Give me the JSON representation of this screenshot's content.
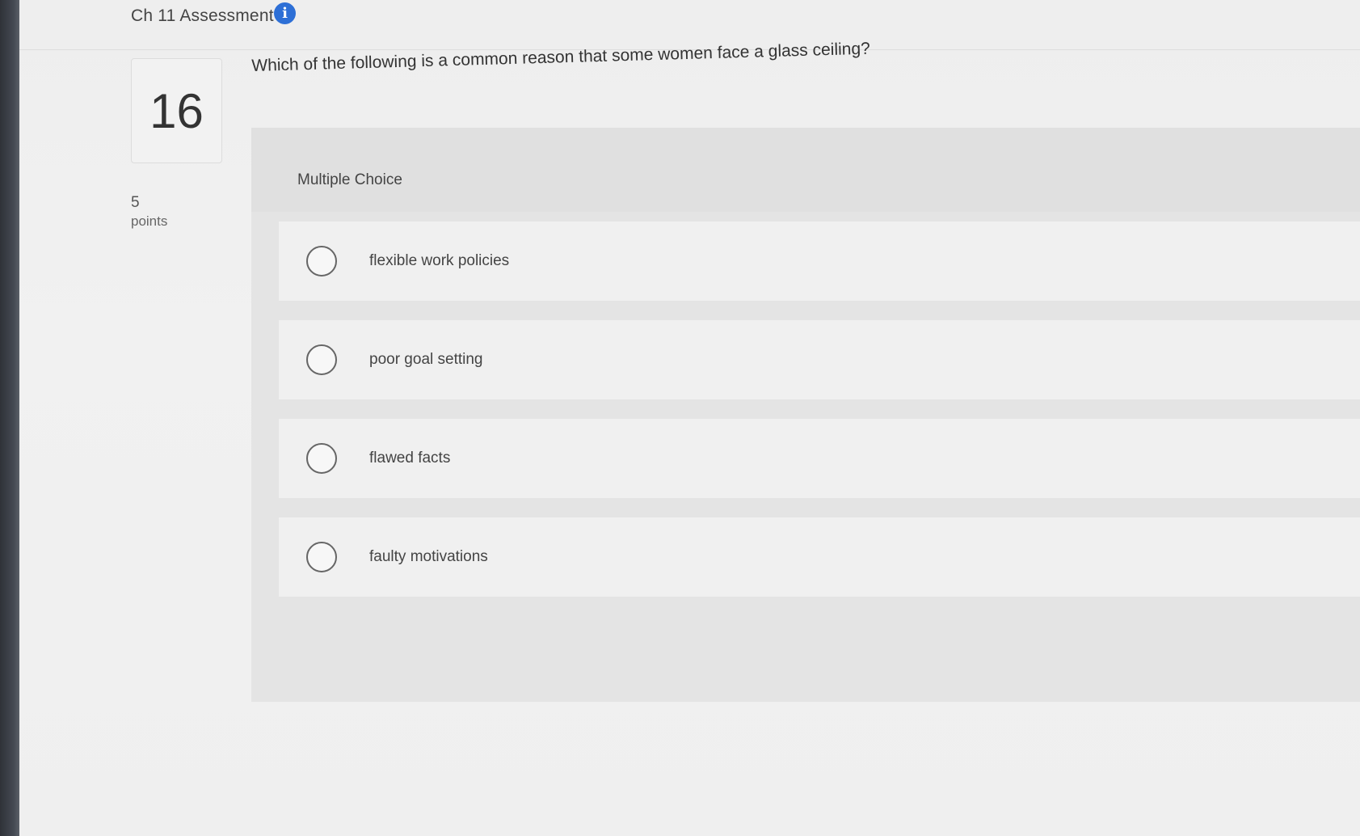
{
  "header": {
    "title": "Ch 11 Assessment",
    "info_icon": "info-icon"
  },
  "question": {
    "number": "16",
    "points_value": "5",
    "points_label": "points",
    "text": "Which of the following is a common reason that some women face a glass ceiling?"
  },
  "answer_area": {
    "type_label": "Multiple Choice",
    "options": [
      {
        "label": "flexible work policies"
      },
      {
        "label": "poor goal setting"
      },
      {
        "label": "flawed facts"
      },
      {
        "label": "faulty motivations"
      }
    ]
  },
  "colors": {
    "accent": "#2d6fd6",
    "panel": "#e4e4e4",
    "option_bg": "#f0f0f0"
  }
}
